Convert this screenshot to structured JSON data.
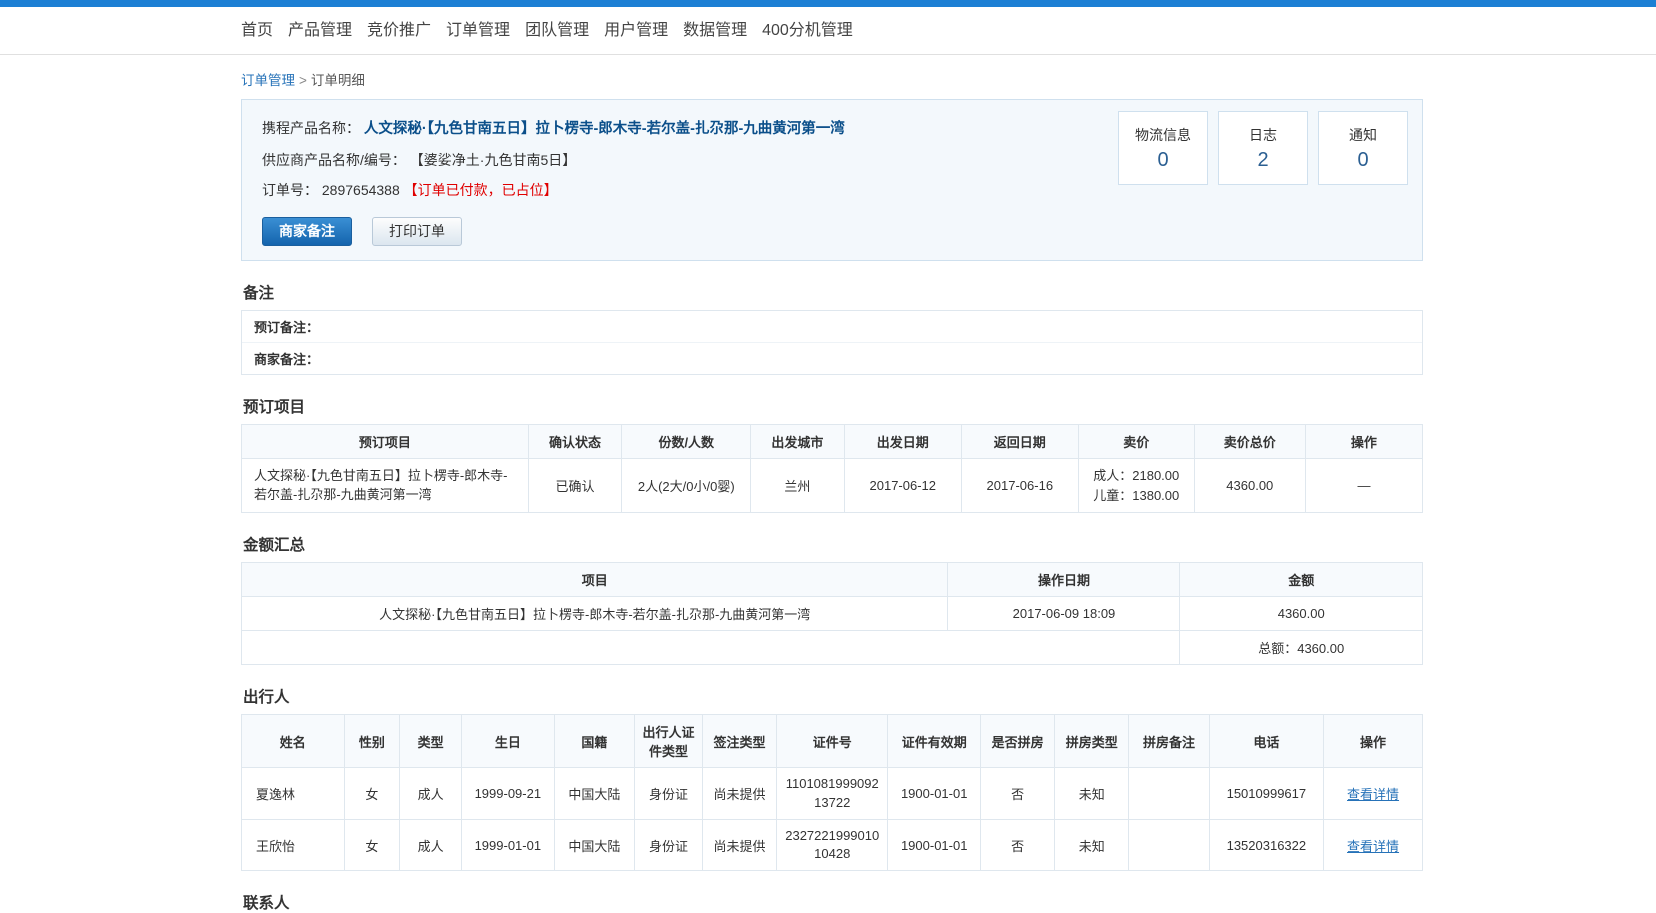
{
  "nav": {
    "items": [
      {
        "label": "首页",
        "name": "nav-home"
      },
      {
        "label": "产品管理",
        "name": "nav-product"
      },
      {
        "label": "竞价推广",
        "name": "nav-bidding"
      },
      {
        "label": "订单管理",
        "name": "nav-order"
      },
      {
        "label": "团队管理",
        "name": "nav-team"
      },
      {
        "label": "用户管理",
        "name": "nav-user"
      },
      {
        "label": "数据管理",
        "name": "nav-data"
      },
      {
        "label": "400分机管理",
        "name": "nav-400"
      }
    ]
  },
  "breadcrumb": {
    "parent": "订单管理",
    "separator": ">",
    "current": "订单明细"
  },
  "order": {
    "product_label": "携程产品名称：",
    "product_name": "人文探秘·【九色甘南五日】拉卜楞寺-郎木寺-若尔盖-扎尕那-九曲黄河第一湾",
    "supplier_label": "供应商产品名称/编号：",
    "supplier_value": "【婆娑净土·九色甘南5日】",
    "order_no_label": "订单号：",
    "order_no": "2897654388",
    "order_status": "【订单已付款，已占位】",
    "buttons": {
      "merchant_remark": "商家备注",
      "print_order": "打印订单"
    },
    "stats": [
      {
        "title": "物流信息",
        "value": "0",
        "name": "stat-logistics"
      },
      {
        "title": "日志",
        "value": "2",
        "name": "stat-log"
      },
      {
        "title": "通知",
        "value": "0",
        "name": "stat-notice"
      }
    ]
  },
  "remarks": {
    "title": "备注",
    "booking_remark_label": "预订备注：",
    "booking_remark_value": "",
    "merchant_remark_label": "商家备注：",
    "merchant_remark_value": ""
  },
  "booking": {
    "title": "预订项目",
    "headers": [
      "预订项目",
      "确认状态",
      "份数/人数",
      "出发城市",
      "出发日期",
      "返回日期",
      "卖价",
      "卖价总价",
      "操作"
    ],
    "rows": [
      {
        "item": "人文探秘·【九色甘南五日】拉卜楞寺-郎木寺-若尔盖-扎尕那-九曲黄河第一湾",
        "status": "已确认",
        "pax": "2人(2大/0小/0婴)",
        "depart_city": "兰州",
        "depart_date": "2017-06-12",
        "return_date": "2017-06-16",
        "price_adult": "成人：2180.00",
        "price_child": "儿童：1380.00",
        "total": "4360.00",
        "action": "—"
      }
    ]
  },
  "amount": {
    "title": "金额汇总",
    "headers": [
      "项目",
      "操作日期",
      "金额"
    ],
    "rows": [
      {
        "item": "人文探秘·【九色甘南五日】拉卜楞寺-郎木寺-若尔盖-扎尕那-九曲黄河第一湾",
        "date": "2017-06-09 18:09",
        "amount": "4360.00"
      }
    ],
    "total_label": "总额：4360.00"
  },
  "travelers": {
    "title": "出行人",
    "headers": [
      "姓名",
      "性别",
      "类型",
      "生日",
      "国籍",
      "出行人证件类型",
      "签注类型",
      "证件号",
      "证件有效期",
      "是否拼房",
      "拼房类型",
      "拼房备注",
      "电话",
      "操作"
    ],
    "rows": [
      {
        "name": "夏逸林",
        "gender": "女",
        "type": "成人",
        "birthday": "1999-09-21",
        "nationality": "中国大陆",
        "id_type": "身份证",
        "visa_type": "尚未提供",
        "id_number": "110108199909213722",
        "id_valid": "1900-01-01",
        "share_room": "否",
        "share_type": "未知",
        "share_remark": "",
        "phone": "15010999617",
        "action": "查看详情"
      },
      {
        "name": "王欣怡",
        "gender": "女",
        "type": "成人",
        "birthday": "1999-01-01",
        "nationality": "中国大陆",
        "id_type": "身份证",
        "visa_type": "尚未提供",
        "id_number": "232722199901010428",
        "id_valid": "1900-01-01",
        "share_room": "否",
        "share_type": "未知",
        "share_remark": "",
        "phone": "13520316322",
        "action": "查看详情"
      }
    ]
  },
  "contacts": {
    "title": "联系人"
  },
  "colors": {
    "brand": "#1c7fd4",
    "link": "#2672b8",
    "alert": "#e00000",
    "panel_bg": "#f3f8fc",
    "panel_border": "#cfe0ee"
  }
}
